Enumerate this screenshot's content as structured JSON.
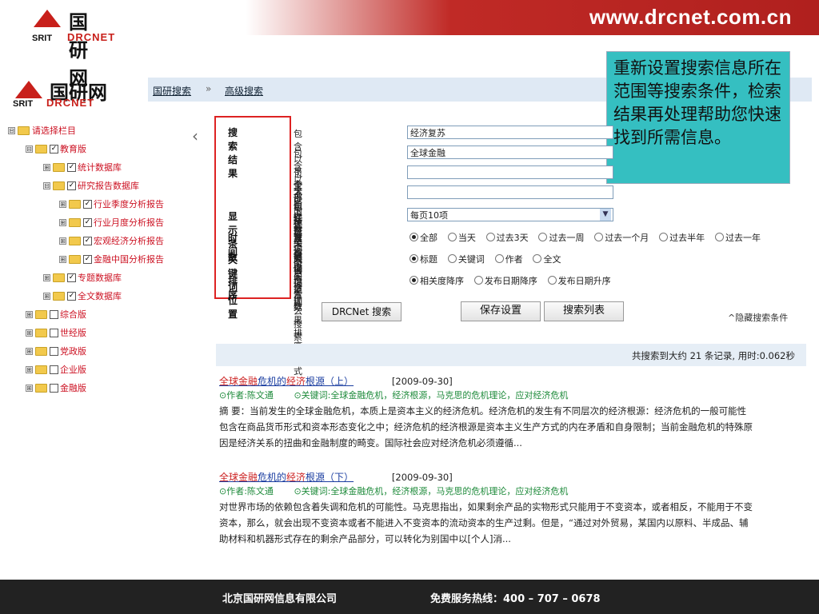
{
  "banner": {
    "url": "www.drcnet.com.cn"
  },
  "logo": {
    "cn": "国研网",
    "srit": "SRIT",
    "drc": "DRCNET"
  },
  "breadcrumb": {
    "items": [
      "国研搜索",
      "高级搜索"
    ],
    "sep": "»"
  },
  "callout": {
    "text": "重新设置搜索信息所在范围等搜索条件，检索结果再处理帮助您快速找到所需信息。"
  },
  "tree": {
    "collapse": "‹",
    "items": [
      {
        "label": "请选择栏目",
        "pm": "⊟",
        "check": false
      },
      {
        "label": "教育版",
        "pm": "⊟",
        "check": true
      },
      {
        "label": "统计数据库",
        "pm": "⊞",
        "check": true
      },
      {
        "label": "研究报告数据库",
        "pm": "⊟",
        "check": true
      },
      {
        "label": "行业季度分析报告",
        "pm": "⊞",
        "check": true
      },
      {
        "label": "行业月度分析报告",
        "pm": "⊞",
        "check": true
      },
      {
        "label": "宏观经济分析报告",
        "pm": "⊞",
        "check": true
      },
      {
        "label": "金融中国分析报告",
        "pm": "⊞",
        "check": true
      },
      {
        "label": "专题数据库",
        "pm": "⊞",
        "check": true
      },
      {
        "label": "全文数据库",
        "pm": "⊞",
        "check": true
      },
      {
        "label": "综合版",
        "pm": "⊞",
        "check": false
      },
      {
        "label": "世经版",
        "pm": "⊞",
        "check": false
      },
      {
        "label": "党政版",
        "pm": "⊞",
        "check": false
      },
      {
        "label": "企业版",
        "pm": "⊞",
        "check": false
      },
      {
        "label": "金融版",
        "pm": "⊞",
        "check": false
      }
    ]
  },
  "form": {
    "labels": {
      "results": "搜索结果",
      "display": "显示条数",
      "time": "时间",
      "keyword_pos": "关键词位置",
      "sort": "排序"
    },
    "all_kw": {
      "pre": "包含以下",
      "em": "全部",
      "post": "的关键词",
      "value": "经济复苏"
    },
    "exact_kw": {
      "pre": "包含以下的",
      "em": "完整关键词",
      "post": "",
      "value": "全球金融"
    },
    "any_kw": {
      "pre": "包含以下",
      "em": "任意一个",
      "post": "关键词",
      "value": ""
    },
    "none_kw": {
      "pre": "",
      "em": "不包括",
      "post": "以下关键词",
      "value": ""
    },
    "display_desc": "搜索结果显示条数",
    "display_value": "每页10项",
    "time_desc": "搜索时间范围",
    "time_options": [
      "全部",
      "当天",
      "过去3天",
      "过去一周",
      "过去一个月",
      "过去半年",
      "过去一年"
    ],
    "kwpos_desc": "限定按什么搜索",
    "kwpos_options": [
      "标题",
      "关键词",
      "作者",
      "全文"
    ],
    "sort_desc": "搜索结果排序方式",
    "sort_options": [
      "相关度降序",
      "发布日期降序",
      "发布日期升序"
    ],
    "btn_search": "DRCNet 搜索",
    "btn_save": "保存设置",
    "btn_list": "搜索列表",
    "hide_link": "隐藏搜索条件",
    "hide_icon": "^"
  },
  "results": {
    "summary": "共搜索到大约 21 条记录, 用时:0.062秒",
    "items": [
      {
        "t1": "全球金融",
        "t2": "危机的",
        "t3": "经济",
        "t4": "根源（上）",
        "date": "[2009-09-30]",
        "author": "⊙作者:陈文通",
        "keywords": "⊙关键词:全球金融危机，经济根源，马克思的危机理论，应对经济危机",
        "abstract": "摘 要：当前发生的全球金融危机，本质上是资本主义的经济危机。经济危机的发生有不同层次的经济根源：经济危机的一般可能性包含在商品货币形式和资本形态变化之中；经济危机的经济根源是资本主义生产方式的内在矛盾和自身限制；当前金融危机的特殊原因是经济关系的扭曲和金融制度的畸变。国际社会应对经济危机必须遵循..."
      },
      {
        "t1": "全球金融",
        "t2": "危机的",
        "t3": "经济",
        "t4": "根源（下）",
        "date": "[2009-09-30]",
        "author": "⊙作者:陈文通",
        "keywords": "⊙关键词:全球金融危机，经济根源，马克思的危机理论，应对经济危机",
        "abstract": "对世界市场的依赖包含着失调和危机的可能性。马克思指出，如果剩余产品的实物形式只能用于不变资本，或者相反，不能用于不变资本，那么，就会出现不变资本或者不能进入不变资本的流动资本的生产过剩。但是，“通过对外贸易，某国内以原料、半成品、辅助材料和机器形式存在的剩余产品部分，可以转化为别国中以[个人]消..."
      }
    ]
  },
  "footer": {
    "company": "北京国研网信息有限公司",
    "hotline": "免费服务热线：400 – 707 – 0678"
  }
}
